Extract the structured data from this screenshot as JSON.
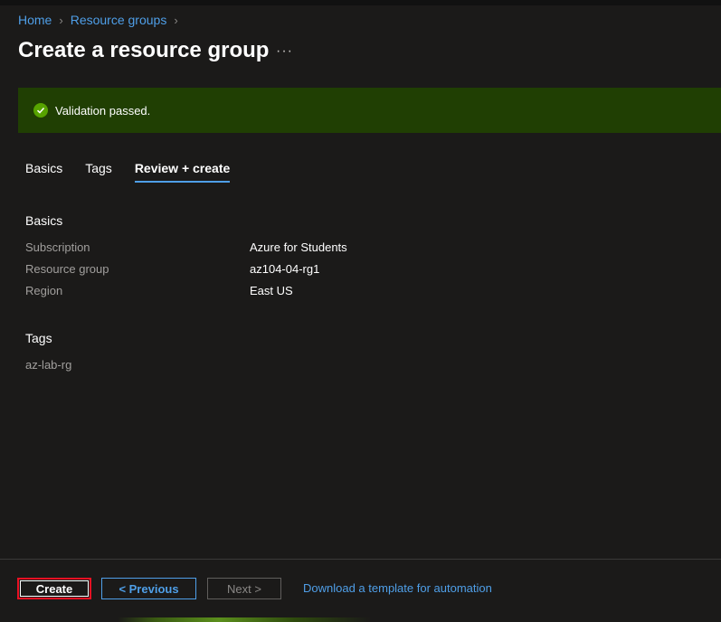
{
  "breadcrumb": {
    "home": "Home",
    "resource_groups": "Resource groups"
  },
  "page": {
    "title": "Create a resource group",
    "more": "···"
  },
  "banner": {
    "text": "Validation passed."
  },
  "tabs": [
    {
      "label": "Basics"
    },
    {
      "label": "Tags"
    },
    {
      "label": "Review + create",
      "active": true
    }
  ],
  "basics": {
    "title": "Basics",
    "rows": [
      {
        "key": "Subscription",
        "value": "Azure for Students"
      },
      {
        "key": "Resource group",
        "value": "az104-04-rg1"
      },
      {
        "key": "Region",
        "value": "East US"
      }
    ]
  },
  "tags": {
    "title": "Tags",
    "value": "az-lab-rg"
  },
  "footer": {
    "create": "Create",
    "previous": "< Previous",
    "next": "Next >",
    "download": "Download a template for automation"
  },
  "colors": {
    "accent": "#4f9fe8",
    "success_bg": "#203f03",
    "success_icon": "#57a300",
    "focus_border": "#e81123"
  }
}
